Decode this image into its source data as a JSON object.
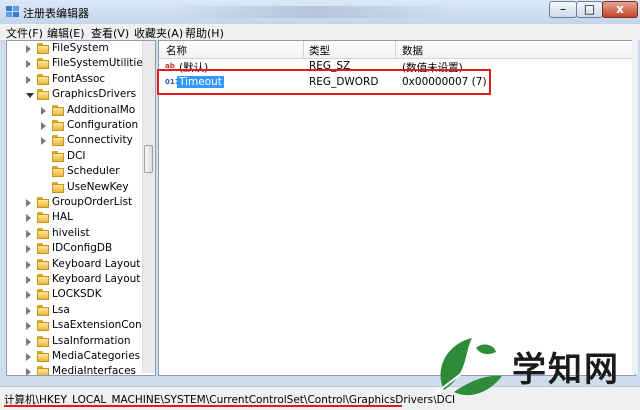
{
  "window": {
    "title": "注册表编辑器",
    "buttons": {
      "minimize": "–",
      "maximize": "□",
      "close": "x"
    }
  },
  "menu": [
    "文件(F)",
    "编辑(E)",
    "查看(V)",
    "收藏夹(A)",
    "帮助(H)"
  ],
  "tree": {
    "items": [
      {
        "label": "FileSystem",
        "state": "collapsed"
      },
      {
        "label": "FileSystemUtilities",
        "state": "collapsed"
      },
      {
        "label": "FontAssoc",
        "state": "collapsed"
      },
      {
        "label": "GraphicsDrivers",
        "state": "expanded"
      },
      {
        "label": "AdditionalMo",
        "state": "collapsed"
      },
      {
        "label": "Configuration",
        "state": "collapsed"
      },
      {
        "label": "Connectivity",
        "state": "collapsed"
      },
      {
        "label": "DCI",
        "state": "leaf"
      },
      {
        "label": "Scheduler",
        "state": "leaf"
      },
      {
        "label": "UseNewKey",
        "state": "leaf"
      },
      {
        "label": "GroupOrderList",
        "state": "collapsed"
      },
      {
        "label": "HAL",
        "state": "collapsed"
      },
      {
        "label": "hivelist",
        "state": "collapsed"
      },
      {
        "label": "IDConfigDB",
        "state": "collapsed"
      },
      {
        "label": "Keyboard Layout",
        "state": "collapsed"
      },
      {
        "label": "Keyboard Layout",
        "state": "collapsed"
      },
      {
        "label": "LOCKSDK",
        "state": "collapsed"
      },
      {
        "label": "Lsa",
        "state": "collapsed"
      },
      {
        "label": "LsaExtensionConf",
        "state": "collapsed"
      },
      {
        "label": "LsaInformation",
        "state": "collapsed"
      },
      {
        "label": "MediaCategories",
        "state": "collapsed"
      },
      {
        "label": "MediaInterfaces",
        "state": "collapsed"
      }
    ]
  },
  "list": {
    "headers": {
      "name": "名称",
      "type": "类型",
      "data": "数据"
    },
    "rows": [
      {
        "icon": "ab",
        "name": "(默认)",
        "type": "REG_SZ",
        "data": "(数值未设置)"
      },
      {
        "icon": "011",
        "name": "Timeout",
        "type": "REG_DWORD",
        "data": "0x00000007 (7)"
      }
    ]
  },
  "status": {
    "path": "计算机\\HKEY_LOCAL_MACHINE\\SYSTEM\\CurrentControlSet\\Control\\GraphicsDrivers\\DCI"
  },
  "watermark": {
    "text": "学知网"
  },
  "colors": {
    "selection": "#3399ff",
    "highlight_box": "#e31a1a",
    "folder": "#e8b83e",
    "leaf_green": "#2e8b3a"
  }
}
